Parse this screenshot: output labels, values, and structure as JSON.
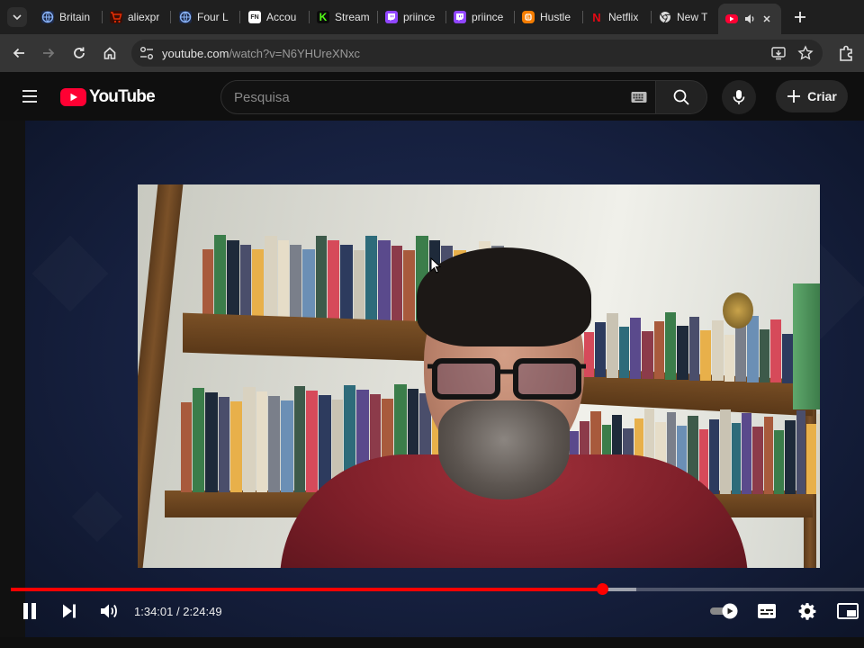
{
  "browser": {
    "tabs": [
      {
        "title": "Britain",
        "icon": "globe-icon",
        "color": "#8ab4f8"
      },
      {
        "title": "aliexpr",
        "icon": "cart-icon",
        "color": "#e62e04"
      },
      {
        "title": "Four L",
        "icon": "globe-icon",
        "color": "#8ab4f8"
      },
      {
        "title": "Accou",
        "icon": "fn-icon",
        "color": "#ffffff"
      },
      {
        "title": "Stream",
        "icon": "kick-icon",
        "color": "#53fc18"
      },
      {
        "title": "priince",
        "icon": "twitch-icon",
        "color": "#9146ff"
      },
      {
        "title": "priince",
        "icon": "twitch-icon",
        "color": "#9146ff"
      },
      {
        "title": "Hustle",
        "icon": "blogger-icon",
        "color": "#f57d00"
      },
      {
        "title": "Netflix",
        "icon": "netflix-icon",
        "color": "#e50914"
      },
      {
        "title": "New T",
        "icon": "chrome-icon",
        "color": "#dddddd"
      }
    ],
    "url": {
      "host": "youtube.com",
      "path": "/watch?v=N6YHUreXNxc"
    }
  },
  "youtube": {
    "logo_text": "YouTube",
    "search_placeholder": "Pesquisa",
    "create_label": "Criar"
  },
  "player": {
    "current_time": "1:34:01",
    "duration": "2:24:49",
    "time_display": "1:34:01 / 2:24:49",
    "progress_fraction": 0.6928,
    "buffer_fraction": 0.7336,
    "state": "playing",
    "autoplay": true
  },
  "colors": {
    "accent": "#ff0033",
    "progress": "#ff0000",
    "chrome_bg": "#1f1f1f",
    "toolbar_bg": "#353535"
  }
}
